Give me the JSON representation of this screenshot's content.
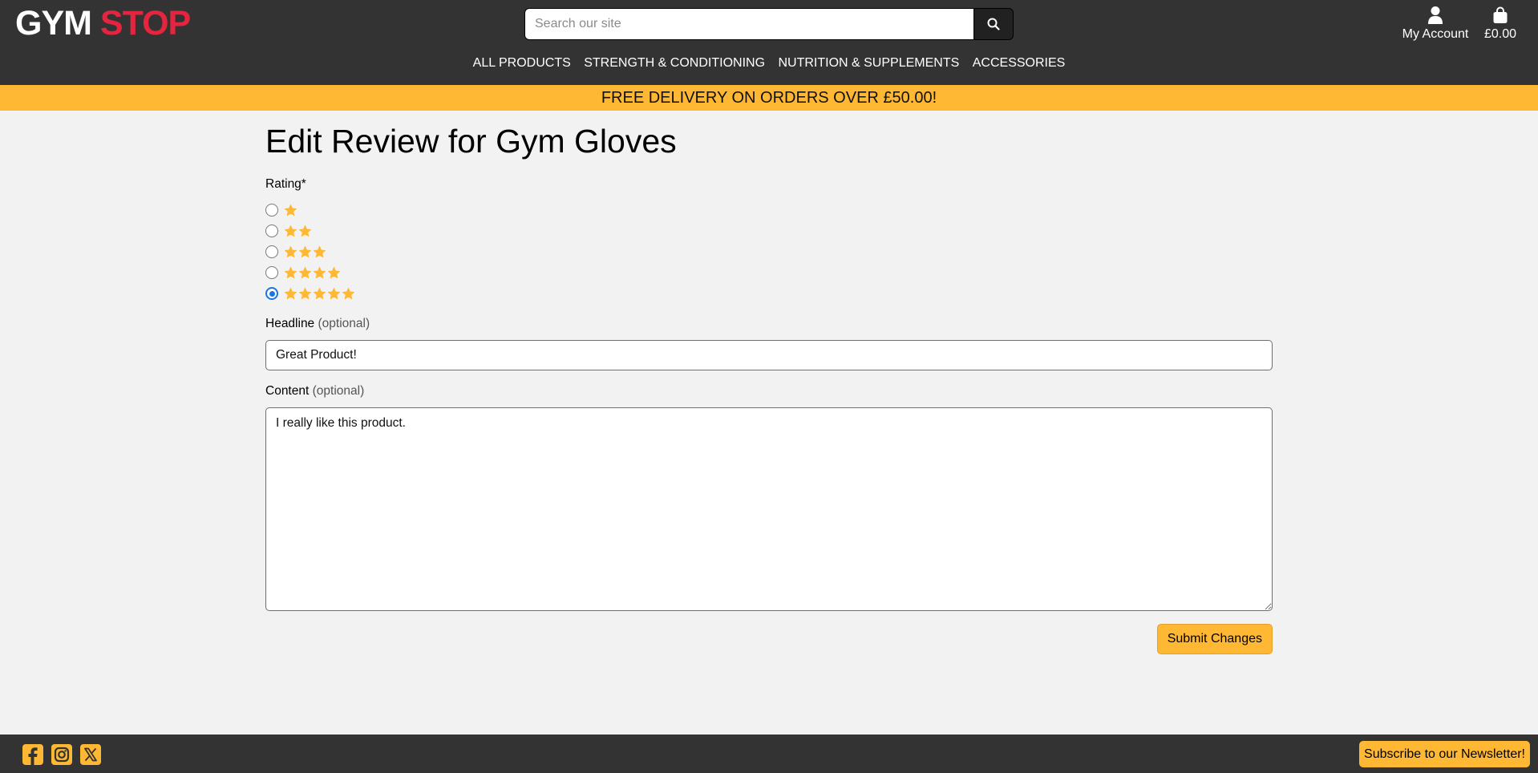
{
  "brand": {
    "part1": "GYM",
    "part2": "STOP",
    "accent": "#e5253f"
  },
  "search": {
    "placeholder": "Search our site",
    "value": ""
  },
  "account": {
    "label": "My Account",
    "icon": "user-icon"
  },
  "bag": {
    "total": "£0.00",
    "icon": "shopping-bag-icon"
  },
  "nav": {
    "items": [
      {
        "label": "ALL PRODUCTS"
      },
      {
        "label": "STRENGTH & CONDITIONING"
      },
      {
        "label": "NUTRITION & SUPPLEMENTS"
      },
      {
        "label": "ACCESSORIES"
      }
    ]
  },
  "banner": {
    "text": "FREE DELIVERY ON ORDERS OVER £50.00!",
    "color": "#ffb834"
  },
  "form": {
    "title": "Edit Review for Gym Gloves",
    "rating_label": "Rating*",
    "rating_options": [
      1,
      2,
      3,
      4,
      5
    ],
    "rating_selected": 5,
    "headline_label": "Headline",
    "headline_optional": "(optional)",
    "headline_value": "Great Product!",
    "content_label": "Content",
    "content_optional": "(optional)",
    "content_value": "I really like this product.",
    "submit_label": "Submit Changes"
  },
  "footer": {
    "social_icons": [
      "facebook-icon",
      "instagram-icon",
      "x-twitter-icon"
    ],
    "newsletter_label": "Subscribe to our Newsletter!"
  },
  "colors": {
    "header_bg": "#333333",
    "accent_yellow": "#ffb834",
    "radio_selected": "#1a73e8"
  }
}
